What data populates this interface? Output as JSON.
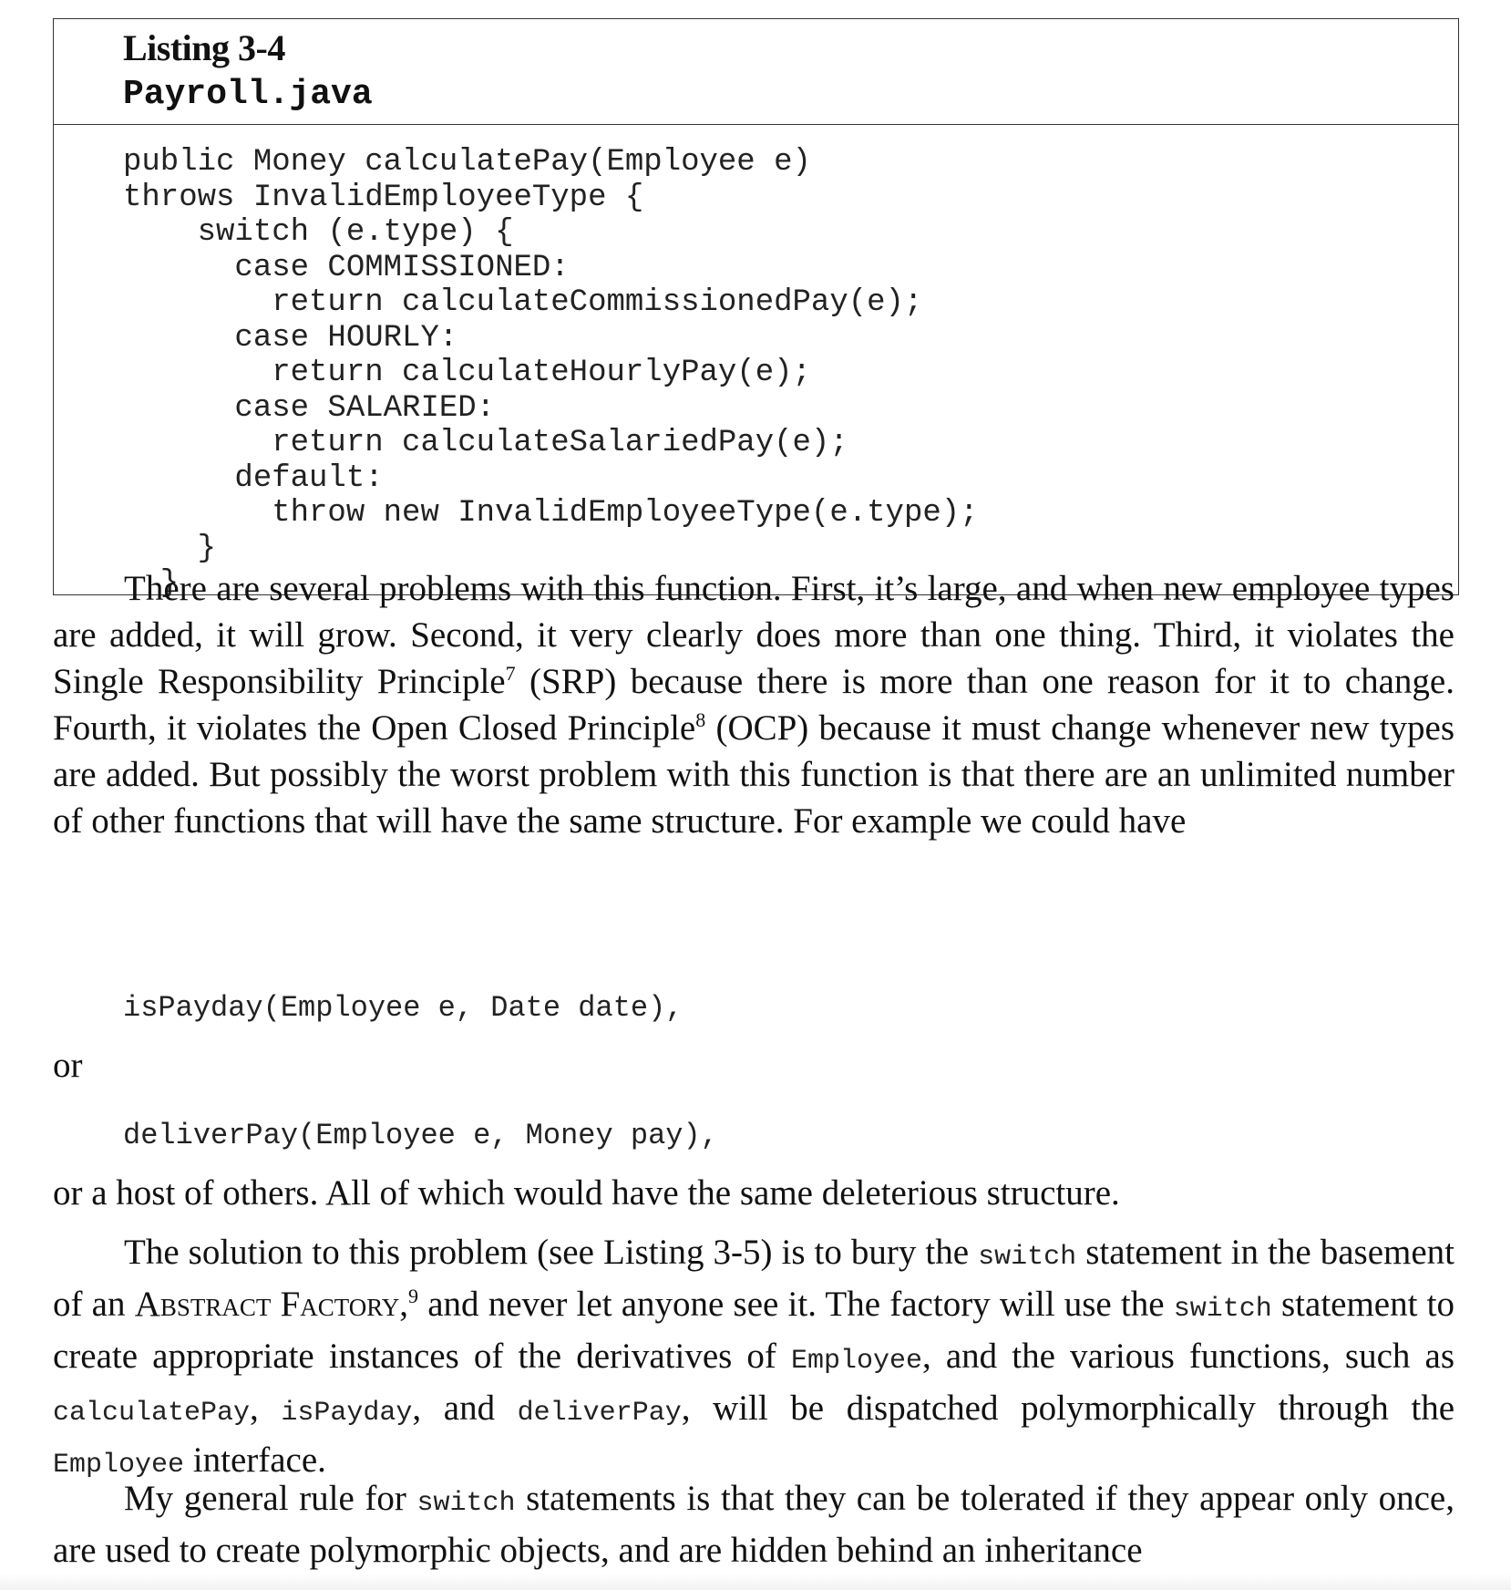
{
  "listing": {
    "label": "Listing 3-4",
    "file": "Payroll.java",
    "code": "public Money calculatePay(Employee e)\nthrows InvalidEmployeeType {\n    switch (e.type) {\n      case COMMISSIONED:\n        return calculateCommissionedPay(e);\n      case HOURLY:\n        return calculateHourlyPay(e);\n      case SALARIED:\n        return calculateSalariedPay(e);\n      default:\n        throw new InvalidEmployeeType(e.type);\n    }\n  }"
  },
  "para1": {
    "t1": "There are several problems with this function. First, it’s large, and when new employee types are added, it will grow. Second, it very clearly does more than one thing. Third, it violates the Single Responsibility Principle",
    "fn7": "7",
    "t2": " (SRP) because there is more than one reason for it to change. Fourth, it violates the Open Closed Principle",
    "fn8": "8",
    "t3": " (OCP) because it must change whenever new types are added. But possibly the worst problem with this function is that there are an unlimited number of other functions that will have the same structure. For example we could have"
  },
  "code_ispayday": "isPayday(Employee e, Date date),",
  "or_text": "or",
  "code_deliverpay": "deliverPay(Employee e, Money pay),",
  "para2": "or a host of others. All of which would have the same deleterious structure.",
  "para3": {
    "t1": "The solution to this problem (see Listing 3-5) is to bury the ",
    "c1": "switch",
    "t2": " statement in the basement of an ",
    "sc": "Abstract Factory",
    "t3": ",",
    "fn9": "9",
    "t4": " and never let anyone see it. The factory will use the ",
    "c2": "switch",
    "t5": " statement to create appropriate instances of the derivatives of ",
    "c3": "Employee",
    "t6": ", and the various functions, such as ",
    "c4": "calculatePay",
    "t7": ", ",
    "c5": "isPayday",
    "t8": ", and ",
    "c6": "deliverPay",
    "t9": ", will be dispatched polymorphically through the ",
    "c7": "Employee",
    "t10": " interface."
  },
  "para4": {
    "t1": "My general rule for ",
    "c1": "switch",
    "t2": " statements is that they can be tolerated if they appear only once, are used to create polymorphic objects, and are hidden behind an inheritance"
  }
}
